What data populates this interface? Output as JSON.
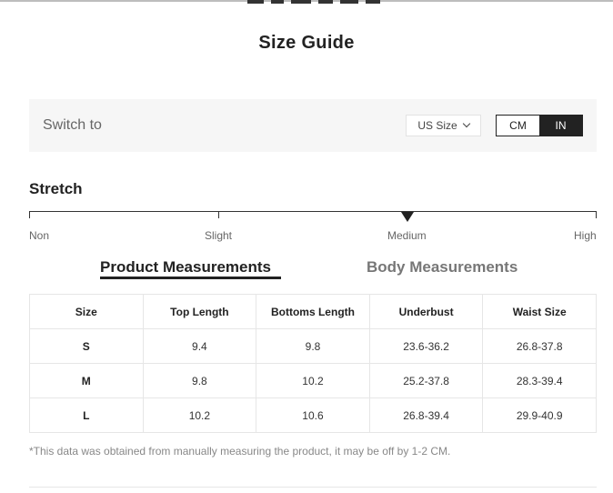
{
  "header": {
    "title": "Size Guide"
  },
  "switch": {
    "label": "Switch to",
    "size_system": "US Size",
    "units": [
      {
        "label": "CM",
        "active": false
      },
      {
        "label": "IN",
        "active": true
      }
    ]
  },
  "stretch": {
    "title": "Stretch",
    "levels": [
      "Non",
      "Slight",
      "Medium",
      "High"
    ],
    "selected": "Medium"
  },
  "tabs": [
    {
      "label": "Product Measurements",
      "active": true
    },
    {
      "label": "Body Measurements",
      "active": false
    }
  ],
  "table": {
    "headers": [
      "Size",
      "Top Length",
      "Bottoms Length",
      "Underbust",
      "Waist Size"
    ],
    "rows": [
      [
        "S",
        "9.4",
        "9.8",
        "23.6-36.2",
        "26.8-37.8"
      ],
      [
        "M",
        "9.8",
        "10.2",
        "25.2-37.8",
        "28.3-39.4"
      ],
      [
        "L",
        "10.2",
        "10.6",
        "26.8-39.4",
        "29.9-40.9"
      ]
    ]
  },
  "note": "*This data was obtained from manually measuring the product, it may be off by 1-2 CM.",
  "colors": {
    "accent": "#222222",
    "muted_text": "#888888",
    "panel_bg": "#f6f6f6"
  }
}
